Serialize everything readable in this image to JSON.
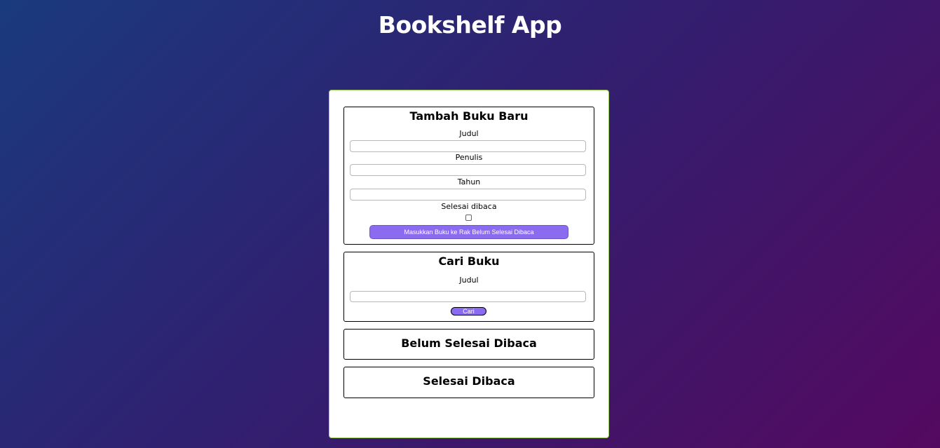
{
  "app": {
    "title": "Bookshelf App"
  },
  "add_book": {
    "title": "Tambah Buku Baru",
    "title_label": "Judul",
    "title_value": "",
    "author_label": "Penulis",
    "author_value": "",
    "year_label": "Tahun",
    "year_value": "",
    "finished_label": "Selesai dibaca",
    "finished_checked": false,
    "submit_label": "Masukkan Buku ke Rak Belum Selesai Dibaca"
  },
  "search_book": {
    "title": "Cari Buku",
    "title_label": "Judul",
    "title_value": "",
    "submit_label": "Cari"
  },
  "shelves": {
    "unfinished_title": "Belum Selesai Dibaca",
    "finished_title": "Selesai Dibaca"
  },
  "colors": {
    "accent": "#8b6cf0",
    "container_border": "#9acd5a",
    "background_start": "#1a3a7e",
    "background_end": "#540960"
  }
}
